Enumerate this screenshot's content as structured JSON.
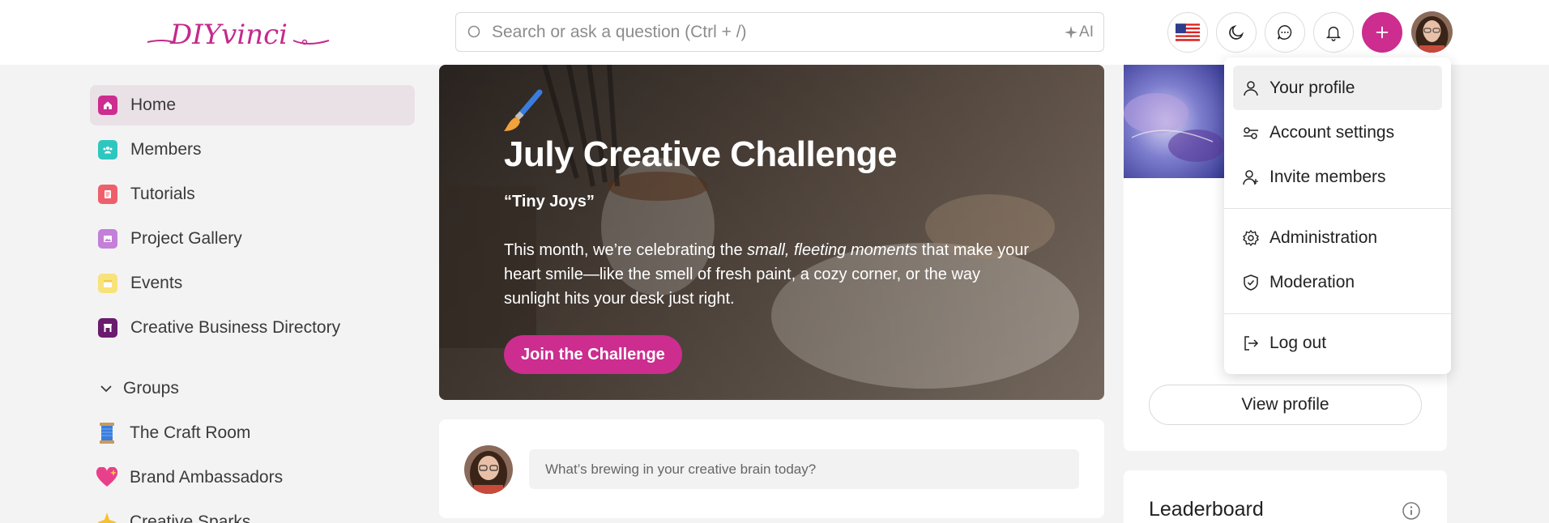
{
  "header": {
    "logo_text": "DIYvinci",
    "search": {
      "placeholder": "Search or ask a question (Ctrl + /)",
      "ai_label": "AI"
    },
    "buttons": [
      "language-flag",
      "dark-mode",
      "messages",
      "notifications",
      "create",
      "profile-avatar"
    ]
  },
  "sidebar": {
    "items": [
      {
        "label": "Home",
        "icon": "home-icon",
        "color": "#cc2d8f",
        "active": true
      },
      {
        "label": "Members",
        "icon": "members-icon",
        "color": "#2ec7c0"
      },
      {
        "label": "Tutorials",
        "icon": "tutorials-icon",
        "color": "#ef5f6b"
      },
      {
        "label": "Project Gallery",
        "icon": "gallery-icon",
        "color": "#c47fd8"
      },
      {
        "label": "Events",
        "icon": "events-icon",
        "color": "#f8e27a"
      },
      {
        "label": "Creative Business Directory",
        "icon": "directory-icon",
        "color": "#6a1b6e"
      }
    ],
    "groups_label": "Groups",
    "groups": [
      {
        "label": "The Craft Room",
        "icon": "spool-icon"
      },
      {
        "label": "Brand Ambassadors",
        "icon": "heart-icon"
      },
      {
        "label": "Creative Sparks",
        "icon": "sparkle-icon"
      }
    ]
  },
  "hero": {
    "title": "July Creative Challenge",
    "subtitle": "“Tiny Joys”",
    "desc_before": "This month, we’re celebrating the ",
    "desc_em": "small, fleeting moments",
    "desc_after": " that make your heart smile—like the smell of fresh paint, a cozy corner, or the way sunlight hits your desk just right.",
    "button_label": "Join the Challenge"
  },
  "composer": {
    "placeholder": "What’s brewing in your creative brain today?"
  },
  "profile_card": {
    "view_profile_label": "View profile"
  },
  "leaderboard": {
    "title": "Leaderboard"
  },
  "dropdown": {
    "items": [
      {
        "label": "Your profile",
        "icon": "user-icon"
      },
      {
        "label": "Account settings",
        "icon": "account-settings-icon"
      },
      {
        "label": "Invite members",
        "icon": "invite-user-icon"
      },
      {
        "label": "Administration",
        "icon": "gear-icon"
      },
      {
        "label": "Moderation",
        "icon": "shield-check-icon"
      },
      {
        "label": "Log out",
        "icon": "logout-icon"
      }
    ]
  },
  "colors": {
    "brand": "#cc2d8f",
    "active_nav_bg": "#eae1e6",
    "page_bg": "#f4f3f3"
  }
}
